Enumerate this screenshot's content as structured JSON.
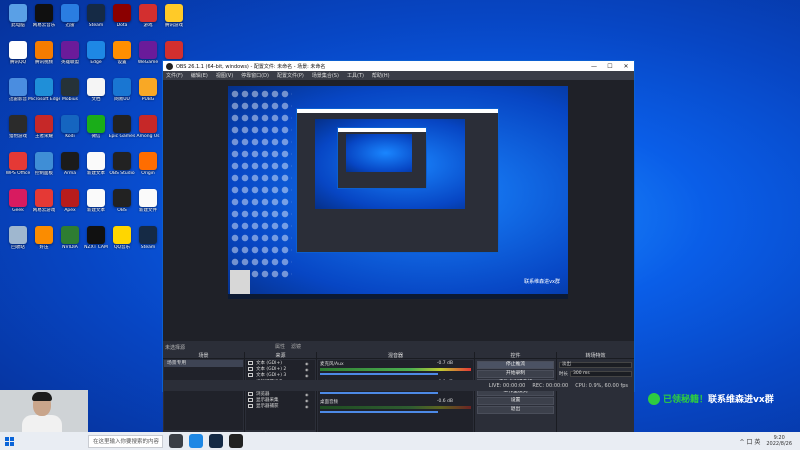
{
  "desktop": {
    "icons": [
      {
        "label": "此电脑",
        "color": "#5aa0e6"
      },
      {
        "label": "腾讯QQ",
        "color": "#ffffff"
      },
      {
        "label": "迅雷影音",
        "color": "#4a8de0"
      },
      {
        "label": "猎豹游戏",
        "color": "#2b2b2b"
      },
      {
        "label": "WPS Office",
        "color": "#e53935"
      },
      {
        "label": "Geek",
        "color": "#d81b60"
      },
      {
        "label": "回收站",
        "color": "#9fb7cf"
      },
      {
        "label": "网易云音乐",
        "color": "#101010"
      },
      {
        "label": "腾讯视频",
        "color": "#f57c00"
      },
      {
        "label": "Microsoft Edge",
        "color": "#1f8fd8"
      },
      {
        "label": "王者荣耀",
        "color": "#c62828"
      },
      {
        "label": "控制面板",
        "color": "#3f8ed6"
      },
      {
        "label": "网易云游戏",
        "color": "#e53935"
      },
      {
        "label": "好压",
        "color": "#fb8c00"
      },
      {
        "label": "迅雷",
        "color": "#2a7de1"
      },
      {
        "label": "英雄联盟",
        "color": "#6a1b9a"
      },
      {
        "label": "Mobius",
        "color": "#263238"
      },
      {
        "label": "Kodi",
        "color": "#1565c0"
      },
      {
        "label": "Arma",
        "color": "#1b1b1b"
      },
      {
        "label": "Apex",
        "color": "#b71c1c"
      },
      {
        "label": "NVIDIA",
        "color": "#2e7d32"
      },
      {
        "label": "Steam",
        "color": "#152a45"
      },
      {
        "label": "Edge",
        "color": "#1e88e5"
      },
      {
        "label": "文档",
        "color": "#f5f5f5"
      },
      {
        "label": "微信",
        "color": "#1aad19"
      },
      {
        "label": "新建文本",
        "color": "#fafafa"
      },
      {
        "label": "新建文本",
        "color": "#fafafa"
      },
      {
        "label": "NZXT CAM",
        "color": "#111111"
      },
      {
        "label": "Dota",
        "color": "#8b0000"
      },
      {
        "label": "设置",
        "color": "#ff8f00"
      },
      {
        "label": "网易UU",
        "color": "#1976d2"
      },
      {
        "label": "Epic Games",
        "color": "#222222"
      },
      {
        "label": "OBS Studio",
        "color": "#222222"
      },
      {
        "label": "OBS",
        "color": "#222222"
      },
      {
        "label": "QQ音乐",
        "color": "#ffd600"
      },
      {
        "label": "游戏",
        "color": "#d32f2f"
      },
      {
        "label": "WeGame",
        "color": "#6a1b9a"
      },
      {
        "label": "PUBG",
        "color": "#f9a825"
      },
      {
        "label": "Among Us",
        "color": "#c62828"
      },
      {
        "label": "Origin",
        "color": "#ff6d00"
      },
      {
        "label": "新建文件",
        "color": "#fafafa"
      },
      {
        "label": "Steam",
        "color": "#152a45"
      },
      {
        "label": "腾讯游戏",
        "color": "#ffca28"
      },
      {
        "label": "Roblox",
        "color": "#d32f2f"
      },
      {
        "label": "小游戏",
        "color": "#ff7043"
      },
      {
        "label": "文件",
        "color": "#fafafa"
      },
      {
        "label": "Battle",
        "color": "#ef6c00"
      }
    ]
  },
  "obs": {
    "title": "OBS 26.1.1 (64-bit, windows) - 配置文件: 未命名 - 场景: 未命名",
    "menu": [
      "文件(F)",
      "编辑(E)",
      "视图(V)",
      "停靠窗口(D)",
      "配置文件(P)",
      "场景集合(S)",
      "工具(T)",
      "帮助(H)"
    ],
    "no_source_selected": "未选择源",
    "context_props": "属性",
    "context_filters": "滤镜",
    "docks": {
      "scenes_title": "场景",
      "scenes": [
        "场景专用"
      ],
      "sources_title": "来源",
      "sources": [
        {
          "name": "文本 (GDI+)"
        },
        {
          "name": "文本 (GDI+) 2"
        },
        {
          "name": "文本 (GDI+) 3"
        },
        {
          "name": "视频捕获设备"
        },
        {
          "name": "图像"
        },
        {
          "name": "浏览器"
        },
        {
          "name": "显示器采集"
        },
        {
          "name": "显示器捕获"
        }
      ],
      "mixer_title": "混音器",
      "mixer": [
        {
          "name": "麦克风/Aux",
          "level": "-0.7 dB",
          "active": true
        },
        {
          "name": "视频捕获设备",
          "level": "0.0 dB",
          "active": true
        },
        {
          "name": "桌面音频",
          "level": "-0.6 dB",
          "active": false
        }
      ],
      "controls_title": "控件",
      "controls": [
        "停止推流",
        "开始录制",
        "启动虚拟摄像机",
        "工作室模式",
        "设置",
        "退出"
      ],
      "transitions_title": "转场特效",
      "transition_type": "淡出",
      "duration_label": "时长",
      "duration_value": "300 ms"
    },
    "status": {
      "live": "LIVE: 00:00:00",
      "rec": "REC: 00:00:00",
      "cpu": "CPU: 0.9%, 60.00 fps"
    },
    "nested_badge": "联系维森进vx群"
  },
  "watermark": {
    "part1": "已领秘籍！",
    "part2": "联系维森进vx群"
  },
  "taskbar": {
    "search_placeholder": "在这里输入你要搜索的内容",
    "time": "9:20",
    "date": "2022/8/26",
    "tray_glyphs": "^ 口 英"
  },
  "colors": {
    "desktop_blue": "#0a5ee8",
    "obs_bg": "#2b2e38",
    "accent_green": "#2ecc40"
  }
}
